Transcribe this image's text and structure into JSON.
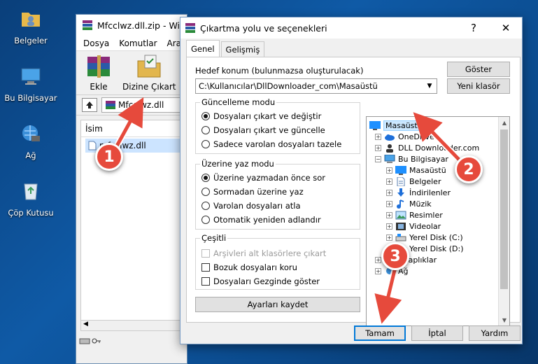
{
  "desktop": {
    "icons": [
      {
        "label": "Belgeler"
      },
      {
        "label": "Bu Bilgisayar"
      },
      {
        "label": "Ağ"
      },
      {
        "label": "Çöp Kutusu"
      }
    ]
  },
  "winrar": {
    "title": "Mfcclwz.dll.zip - Win",
    "menu": [
      "Dosya",
      "Komutlar",
      "Araçla"
    ],
    "toolbar": {
      "add_label": "Ekle",
      "extract_label": "Dizine Çıkart"
    },
    "path": "Mfcclwz.dll",
    "list_header": "İsim",
    "file_name": "mfcclwz.dll"
  },
  "dialog": {
    "title": "Çıkartma yolu ve seçenekleri",
    "help_glyph": "?",
    "close_glyph": "✕",
    "tabs": [
      "Genel",
      "Gelişmiş"
    ],
    "dest_label": "Hedef konum (bulunmazsa oluşturulacak)",
    "dest_value": "C:\\Kullanıcılar\\DllDownloader_com\\Masaüstü",
    "show_button": "Göster",
    "new_folder_button": "Yeni klasör",
    "update_mode": {
      "title": "Güncelleme modu",
      "options": [
        "Dosyaları çıkart ve değiştir",
        "Dosyaları çıkart ve güncelle",
        "Sadece varolan dosyaları tazele"
      ],
      "selected": 0
    },
    "overwrite_mode": {
      "title": "Üzerine yaz modu",
      "options": [
        "Üzerine yazmadan önce sor",
        "Sormadan üzerine yaz",
        "Varolan dosyaları atla",
        "Otomatik yeniden adlandır"
      ],
      "selected": 0
    },
    "misc": {
      "title": "Çeşitli",
      "options": [
        "Arşivleri alt klasörlere çıkart",
        "Bozuk dosyaları koru",
        "Dosyaları Gezginde göster"
      ]
    },
    "save_settings_button": "Ayarları kaydet",
    "tree": [
      {
        "label": "Masaüstü",
        "icon": "desktop-icon"
      },
      {
        "label": "OneDrive",
        "icon": "cloud-icon"
      },
      {
        "label": "DLL Downloader.com",
        "icon": "user-icon"
      },
      {
        "label": "Bu Bilgisayar",
        "icon": "computer-icon"
      },
      {
        "label": "Masaüstü",
        "icon": "desktop-icon"
      },
      {
        "label": "Belgeler",
        "icon": "document-icon"
      },
      {
        "label": "İndirilenler",
        "icon": "download-icon"
      },
      {
        "label": "Müzik",
        "icon": "music-icon"
      },
      {
        "label": "Resimler",
        "icon": "picture-icon"
      },
      {
        "label": "Videolar",
        "icon": "video-icon"
      },
      {
        "label": "Yerel Disk (C:)",
        "icon": "drive-icon"
      },
      {
        "label": "Yerel Disk (D:)",
        "icon": "drive-icon"
      },
      {
        "label": "Kitaplıklar",
        "icon": "folder-icon"
      },
      {
        "label": "Ağ",
        "icon": "network-icon"
      }
    ],
    "ok_button": "Tamam",
    "cancel_button": "İptal",
    "help_button": "Yardım"
  },
  "callouts": [
    "1",
    "2",
    "3"
  ],
  "colors": {
    "callout": "#e64a3c",
    "selection": "#cce8ff",
    "accent": "#0078d7"
  }
}
